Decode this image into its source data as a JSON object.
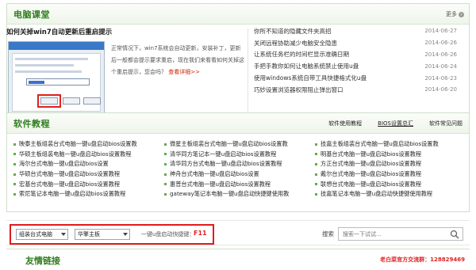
{
  "computer_class": {
    "title": "电脑课堂",
    "more_label": "更多",
    "feature": {
      "title": "如何关掉win7自动更新后重启提示",
      "description": "正常情况下，win7系统会自动更新，安装补丁，更新后一般都会提示要求重启，现在我们来看看如何关掉这个重启提示，您会吗？",
      "detail_link": "查看详细>>"
    },
    "news": [
      {
        "title": "你所不知道的隐藏文件夹高招",
        "date": "2014-06-27"
      },
      {
        "title": "关闭远程协助减少电脑安全隐患",
        "date": "2014-06-26"
      },
      {
        "title": "让系统任务栏的时间栏显示准确日期",
        "date": "2014-06-26"
      },
      {
        "title": "手把手教你如何让电脑系统禁止使用u盘",
        "date": "2014-06-24"
      },
      {
        "title": "使用windows系统自带工具快捷格式化u盘",
        "date": "2014-06-23"
      },
      {
        "title": "巧妙设置浏览器权限阻止弹出窗口",
        "date": "2014-06-20"
      }
    ]
  },
  "software": {
    "title": "软件教程",
    "tabs": [
      "软件使用教程",
      "BIOS设置总汇",
      "软件常见问题"
    ],
    "items": [
      "映泰主板组装台式电脑一键u盘启动bios设置教",
      "微星主板组装台式电脑一键u盘启动bios设置教",
      "技嘉主板组装台式电脑一键u盘启动bios设置教",
      "华硕主板组装电脑一键u盘启动bios设置教程",
      "清华同方笔记本一键u盘启动bios设置教程",
      "明基台式电脑一键u盘启动bios设置教程",
      "海尔台式电脑一键u盘启动bios设置",
      "清华同方台式电脑一键u盘启动bios设置教程",
      "方正台式电脑一键u盘启动bios设置教程",
      "华硕台式电脑一键u盘启动bios设置教程",
      "神舟台式电脑一键u盘启动bios设置",
      "戴尔台式电脑一键u盘启动bios设置教程",
      "宏基台式电脑一键u盘启动bios设置教程",
      "惠普台式电脑一键u盘启动bios设置教程",
      "联想台式电脑一键u盘启动bios设置教程",
      "索尼笔记本电脑一键u盘启动bios设置教程",
      "gateway笔记本电脑一键u盘启动快捷键使用教",
      "技嘉笔记本电脑一键u盘启动快捷键使用教程"
    ]
  },
  "searchbar": {
    "type_select": "组装台式电脑",
    "brand_select": "华擎主板",
    "hotkey_label": "一键u盘启动快捷键：",
    "hotkey_value": "F11",
    "search_label": "搜索",
    "search_placeholder": "搜索一下试试..."
  },
  "friends": {
    "title": "友情链接",
    "contact": "老白菜官方交流群：128829469"
  },
  "colors": {
    "accent_green": "#2f7d1e",
    "highlight_red": "#e02020"
  }
}
